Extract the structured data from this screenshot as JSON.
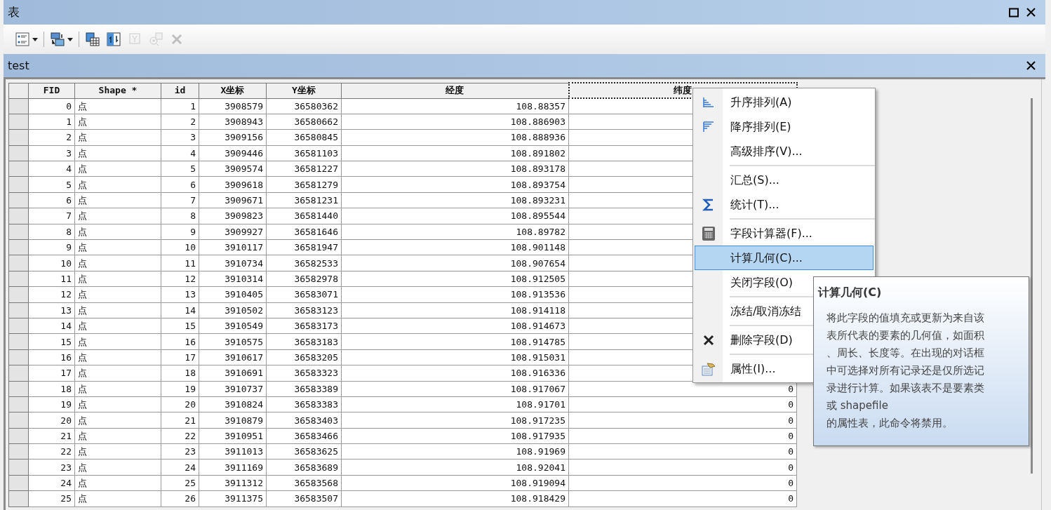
{
  "window": {
    "title": "表"
  },
  "toolbar": [
    {
      "kind": "table-options",
      "dropdown": true,
      "disabled": false
    },
    {
      "kind": "related-tables",
      "dropdown": true,
      "disabled": false
    },
    {
      "kind": "select-by-attributes",
      "dropdown": false,
      "disabled": false
    },
    {
      "kind": "switch-selection",
      "dropdown": false,
      "disabled": false
    },
    {
      "kind": "clear-selection",
      "dropdown": false,
      "disabled": true
    },
    {
      "kind": "zoom-to-selected",
      "dropdown": false,
      "disabled": true
    },
    {
      "kind": "delete",
      "dropdown": false,
      "disabled": true
    }
  ],
  "table_tab": {
    "title": "test"
  },
  "table": {
    "columns": [
      {
        "label": "FID",
        "selected": false
      },
      {
        "label": "Shape *",
        "selected": false
      },
      {
        "label": "id",
        "selected": false
      },
      {
        "label": "X坐标",
        "selected": false
      },
      {
        "label": "Y坐标",
        "selected": false
      },
      {
        "label": "经度",
        "selected": false
      },
      {
        "label": "纬度",
        "selected": true
      }
    ],
    "rows": [
      [
        "0",
        "点",
        "1",
        "3908579",
        "36580362",
        "108.88357"
      ],
      [
        "1",
        "点",
        "2",
        "3908943",
        "36580662",
        "108.886903"
      ],
      [
        "2",
        "点",
        "3",
        "3909156",
        "36580845",
        "108.888936"
      ],
      [
        "3",
        "点",
        "4",
        "3909446",
        "36581103",
        "108.891802"
      ],
      [
        "4",
        "点",
        "5",
        "3909574",
        "36581227",
        "108.893178"
      ],
      [
        "5",
        "点",
        "6",
        "3909618",
        "36581279",
        "108.893754"
      ],
      [
        "6",
        "点",
        "7",
        "3909671",
        "36581231",
        "108.893231"
      ],
      [
        "7",
        "点",
        "8",
        "3909823",
        "36581440",
        "108.895544"
      ],
      [
        "8",
        "点",
        "9",
        "3909927",
        "36581646",
        "108.89782"
      ],
      [
        "9",
        "点",
        "10",
        "3910117",
        "36581947",
        "108.901148"
      ],
      [
        "10",
        "点",
        "11",
        "3910734",
        "36582533",
        "108.907654"
      ],
      [
        "11",
        "点",
        "12",
        "3910314",
        "36582978",
        "108.912505"
      ],
      [
        "12",
        "点",
        "13",
        "3910405",
        "36583071",
        "108.913536"
      ],
      [
        "13",
        "点",
        "14",
        "3910502",
        "36583123",
        "108.914118"
      ],
      [
        "14",
        "点",
        "15",
        "3910549",
        "36583173",
        "108.914673"
      ],
      [
        "15",
        "点",
        "16",
        "3910575",
        "36583183",
        "108.914785"
      ],
      [
        "16",
        "点",
        "17",
        "3910617",
        "36583205",
        "108.915031"
      ],
      [
        "17",
        "点",
        "18",
        "3910691",
        "36583323",
        "108.916336"
      ],
      [
        "18",
        "点",
        "19",
        "3910737",
        "36583389",
        "108.917067",
        "0"
      ],
      [
        "19",
        "点",
        "20",
        "3910824",
        "36583383",
        "108.91701",
        "0"
      ],
      [
        "20",
        "点",
        "21",
        "3910879",
        "36583403",
        "108.917235",
        "0"
      ],
      [
        "21",
        "点",
        "22",
        "3910951",
        "36583466",
        "108.917935",
        "0"
      ],
      [
        "22",
        "点",
        "23",
        "3911013",
        "36583625",
        "108.91969",
        "0"
      ],
      [
        "23",
        "点",
        "24",
        "3911169",
        "36583689",
        "108.92041",
        "0"
      ],
      [
        "24",
        "点",
        "25",
        "3911312",
        "36583568",
        "108.919094",
        "0"
      ],
      [
        "25",
        "点",
        "26",
        "3911375",
        "36583507",
        "108.918429",
        "0"
      ]
    ]
  },
  "context_menu": {
    "groups": [
      [
        {
          "label": "升序排列(A)",
          "kind": "ascending",
          "selected": false
        },
        {
          "label": "降序排列(E)",
          "kind": "descending",
          "selected": false
        },
        {
          "label": "高级排序(V)...",
          "kind": "plain",
          "selected": false
        }
      ],
      [
        {
          "label": "汇总(S)...",
          "kind": "plain",
          "selected": false
        },
        {
          "label": "统计(T)...",
          "kind": "statistics",
          "selected": false
        }
      ],
      [
        {
          "label": "字段计算器(F)...",
          "kind": "calculator",
          "selected": false
        },
        {
          "label": "计算几何(C)...",
          "kind": "plain",
          "selected": true
        },
        {
          "label": "关闭字段(O)",
          "kind": "plain",
          "selected": false
        }
      ],
      [
        {
          "label": "冻结/取消冻结",
          "kind": "plain",
          "selected": false
        }
      ],
      [
        {
          "label": "删除字段(D)",
          "kind": "delete",
          "selected": false
        }
      ],
      [
        {
          "label": "属性(I)...",
          "kind": "properties",
          "selected": false
        }
      ]
    ]
  },
  "tooltip": {
    "title": "计算几何(C)",
    "lines": [
      "将此字段的值填充或更新为来自该",
      "表所代表的要素的几何值，如面积",
      "、周长、长度等。在出现的对话框",
      "中可选择对所有记录还是仅所选记",
      "录进行计算。如果该表不是要素类",
      "或 shapefile",
      "的属性表，此命令将禁用。"
    ]
  }
}
